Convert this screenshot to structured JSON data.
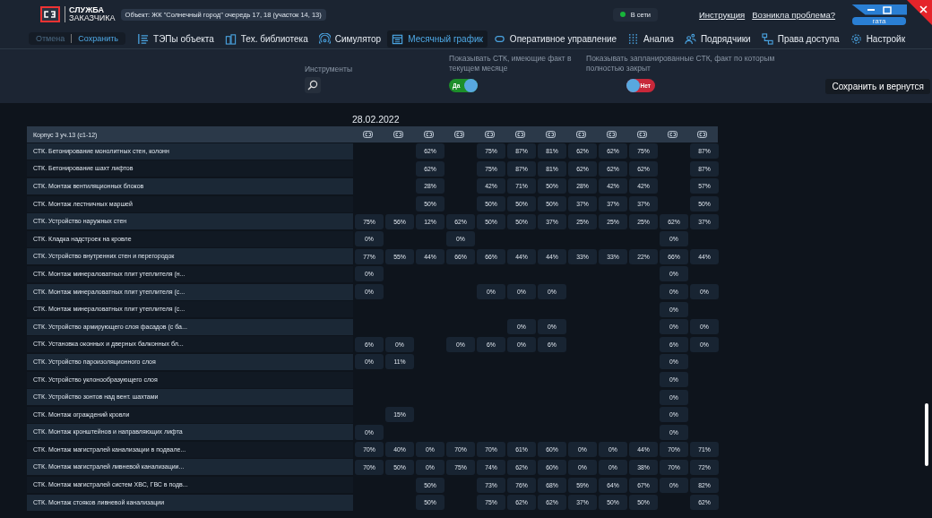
{
  "app": {
    "logo_line1": "СЛУЖБА",
    "logo_line2": "ЗАКАЗЧИКА",
    "object": "Объект: ЖК \"Солнечный город\" очередь 17, 18 (участок 14, 13)",
    "status": "В сети",
    "online": true,
    "links": [
      "Инструкция",
      "Возникла проблема?"
    ],
    "user": "гата"
  },
  "actions": [
    {
      "label": "Отмена",
      "disabled": true
    },
    {
      "label": "Сохранить",
      "disabled": false
    }
  ],
  "tabs": [
    {
      "label": "ТЭПы объекта",
      "selected": false
    },
    {
      "label": "Тех. библиотека",
      "selected": false
    },
    {
      "label": "Симулятор",
      "selected": false
    },
    {
      "label": "Месячный график",
      "selected": true
    },
    {
      "label": "Оперативное управление",
      "selected": false
    },
    {
      "label": "Анализ",
      "selected": false
    },
    {
      "label": "Подрядчики",
      "selected": false
    },
    {
      "label": "Права доступа",
      "selected": false
    },
    {
      "label": "Настройк",
      "selected": false
    }
  ],
  "filters": {
    "tools_label": "Инструменты",
    "toggles": [
      {
        "label": "Показывать СТК, имеющие факт в текущем месяце",
        "on": true,
        "text": "Да"
      },
      {
        "label": "Показывать запланированные СТК, факт по которым полностью закрыт",
        "on": false,
        "text": "Нет"
      }
    ],
    "save_button": "Сохранить и вернутся"
  },
  "table": {
    "date": "28.02.2022",
    "group": "Корпус 3 уч.13 (с1-12)",
    "rows": [
      {
        "name": "СТК. Бетонирование монолитных стен, колонн",
        "cells": {
          "column_3": "62%",
          "column_5": "75%",
          "column_6": "87%",
          "column_7": "81%",
          "column_8": "62%",
          "column_9": "62%",
          "column_10": "75%",
          "column_12": "87%"
        }
      },
      {
        "name": "СТК. Бетонирование шахт лифтов",
        "cells": {
          "column_3": "62%",
          "column_5": "75%",
          "column_6": "87%",
          "column_7": "81%",
          "column_8": "62%",
          "column_9": "62%",
          "column_10": "62%",
          "column_12": "87%"
        }
      },
      {
        "name": "СТК. Монтаж вентиляционных блоков",
        "cells": {
          "column_3": "28%",
          "column_5": "42%",
          "column_6": "71%",
          "column_7": "50%",
          "column_8": "28%",
          "column_9": "42%",
          "column_10": "42%",
          "column_12": "57%"
        }
      },
      {
        "name": "СТК. Монтаж лестничных маршей",
        "cells": {
          "column_3": "50%",
          "column_5": "50%",
          "column_6": "50%",
          "column_7": "50%",
          "column_8": "37%",
          "column_9": "37%",
          "column_10": "37%",
          "column_12": "50%"
        }
      },
      {
        "name": "СТК. Устройство наружных стен",
        "cells": {
          "column_1": "75%",
          "column_2": "56%",
          "column_3": "12%",
          "column_4": "62%",
          "column_5": "50%",
          "column_6": "50%",
          "column_7": "37%",
          "column_8": "25%",
          "column_9": "25%",
          "column_10": "25%",
          "column_11": "62%",
          "column_12": "37%"
        }
      },
      {
        "name": "СТК. Кладка надстроек на кровле",
        "cells": {
          "column_1": "0%",
          "column_4": "0%",
          "column_11": "0%"
        }
      },
      {
        "name": "СТК. Устройство внутренних стен и перегородок",
        "cells": {
          "column_1": "77%",
          "column_2": "55%",
          "column_3": "44%",
          "column_4": "66%",
          "column_5": "66%",
          "column_6": "44%",
          "column_7": "44%",
          "column_8": "33%",
          "column_9": "33%",
          "column_10": "22%",
          "column_11": "66%",
          "column_12": "44%"
        }
      },
      {
        "name": "СТК. Монтаж минераловатных плит утеплителя (н...",
        "cells": {
          "column_1": "0%",
          "column_11": "0%"
        }
      },
      {
        "name": "СТК. Монтаж минераловатных плит утеплителя (с...",
        "cells": {
          "column_1": "0%",
          "column_5": "0%",
          "column_6": "0%",
          "column_7": "0%",
          "column_11": "0%",
          "column_12": "0%"
        }
      },
      {
        "name": "СТК. Монтаж минераловатных плит утеплителя (с...",
        "cells": {
          "column_11": "0%"
        }
      },
      {
        "name": "СТК. Устройство армирующего слоя фасадов (с ба...",
        "cells": {
          "column_6": "0%",
          "column_7": "0%",
          "column_11": "0%",
          "column_12": "0%"
        }
      },
      {
        "name": "СТК. Установка оконных и дверных балконных бл...",
        "cells": {
          "column_1": "6%",
          "column_2": "0%",
          "column_4": "0%",
          "column_5": "6%",
          "column_6": "0%",
          "column_7": "6%",
          "column_11": "6%",
          "column_12": "0%"
        }
      },
      {
        "name": "СТК. Устройство пароизоляционного слоя",
        "cells": {
          "column_1": "0%",
          "column_2": "11%",
          "column_11": "0%"
        }
      },
      {
        "name": "СТК. Устройство уклонообразующего слоя",
        "cells": {
          "column_11": "0%"
        }
      },
      {
        "name": "СТК. Устройство зонтов над вент. шахтами",
        "cells": {
          "column_11": "0%"
        }
      },
      {
        "name": "СТК. Монтаж ограждений кровли",
        "cells": {
          "column_2": "15%",
          "column_11": "0%"
        }
      },
      {
        "name": "СТК. Монтаж кронштейнов и направляющих лифта",
        "cells": {
          "column_1": "0%",
          "column_11": "0%"
        }
      },
      {
        "name": "СТК. Монтаж магистралей канализации в подвале...",
        "cells": {
          "column_1": "70%",
          "column_2": "40%",
          "column_3": "0%",
          "column_4": "70%",
          "column_5": "70%",
          "column_6": "61%",
          "column_7": "60%",
          "column_8": "0%",
          "column_9": "0%",
          "column_10": "44%",
          "column_11": "70%",
          "column_12": "71%"
        }
      },
      {
        "name": "СТК. Монтаж магистралей ливневой канализации...",
        "cells": {
          "column_1": "70%",
          "column_2": "50%",
          "column_3": "0%",
          "column_4": "75%",
          "column_5": "74%",
          "column_6": "62%",
          "column_7": "60%",
          "column_8": "0%",
          "column_9": "0%",
          "column_10": "38%",
          "column_11": "70%",
          "column_12": "72%"
        }
      },
      {
        "name": "СТК. Монтаж магистралей систем ХВС, ГВС в подв...",
        "cells": {
          "column_3": "50%",
          "column_5": "73%",
          "column_6": "76%",
          "column_7": "68%",
          "column_8": "59%",
          "column_9": "64%",
          "column_10": "67%",
          "column_11": "0%",
          "column_12": "82%"
        }
      },
      {
        "name": "СТК. Монтаж стояков ливневой канализации",
        "cells": {
          "column_3": "50%",
          "column_5": "75%",
          "column_6": "62%",
          "column_7": "62%",
          "column_8": "37%",
          "column_9": "50%",
          "column_10": "50%",
          "column_12": "62%"
        }
      }
    ]
  }
}
